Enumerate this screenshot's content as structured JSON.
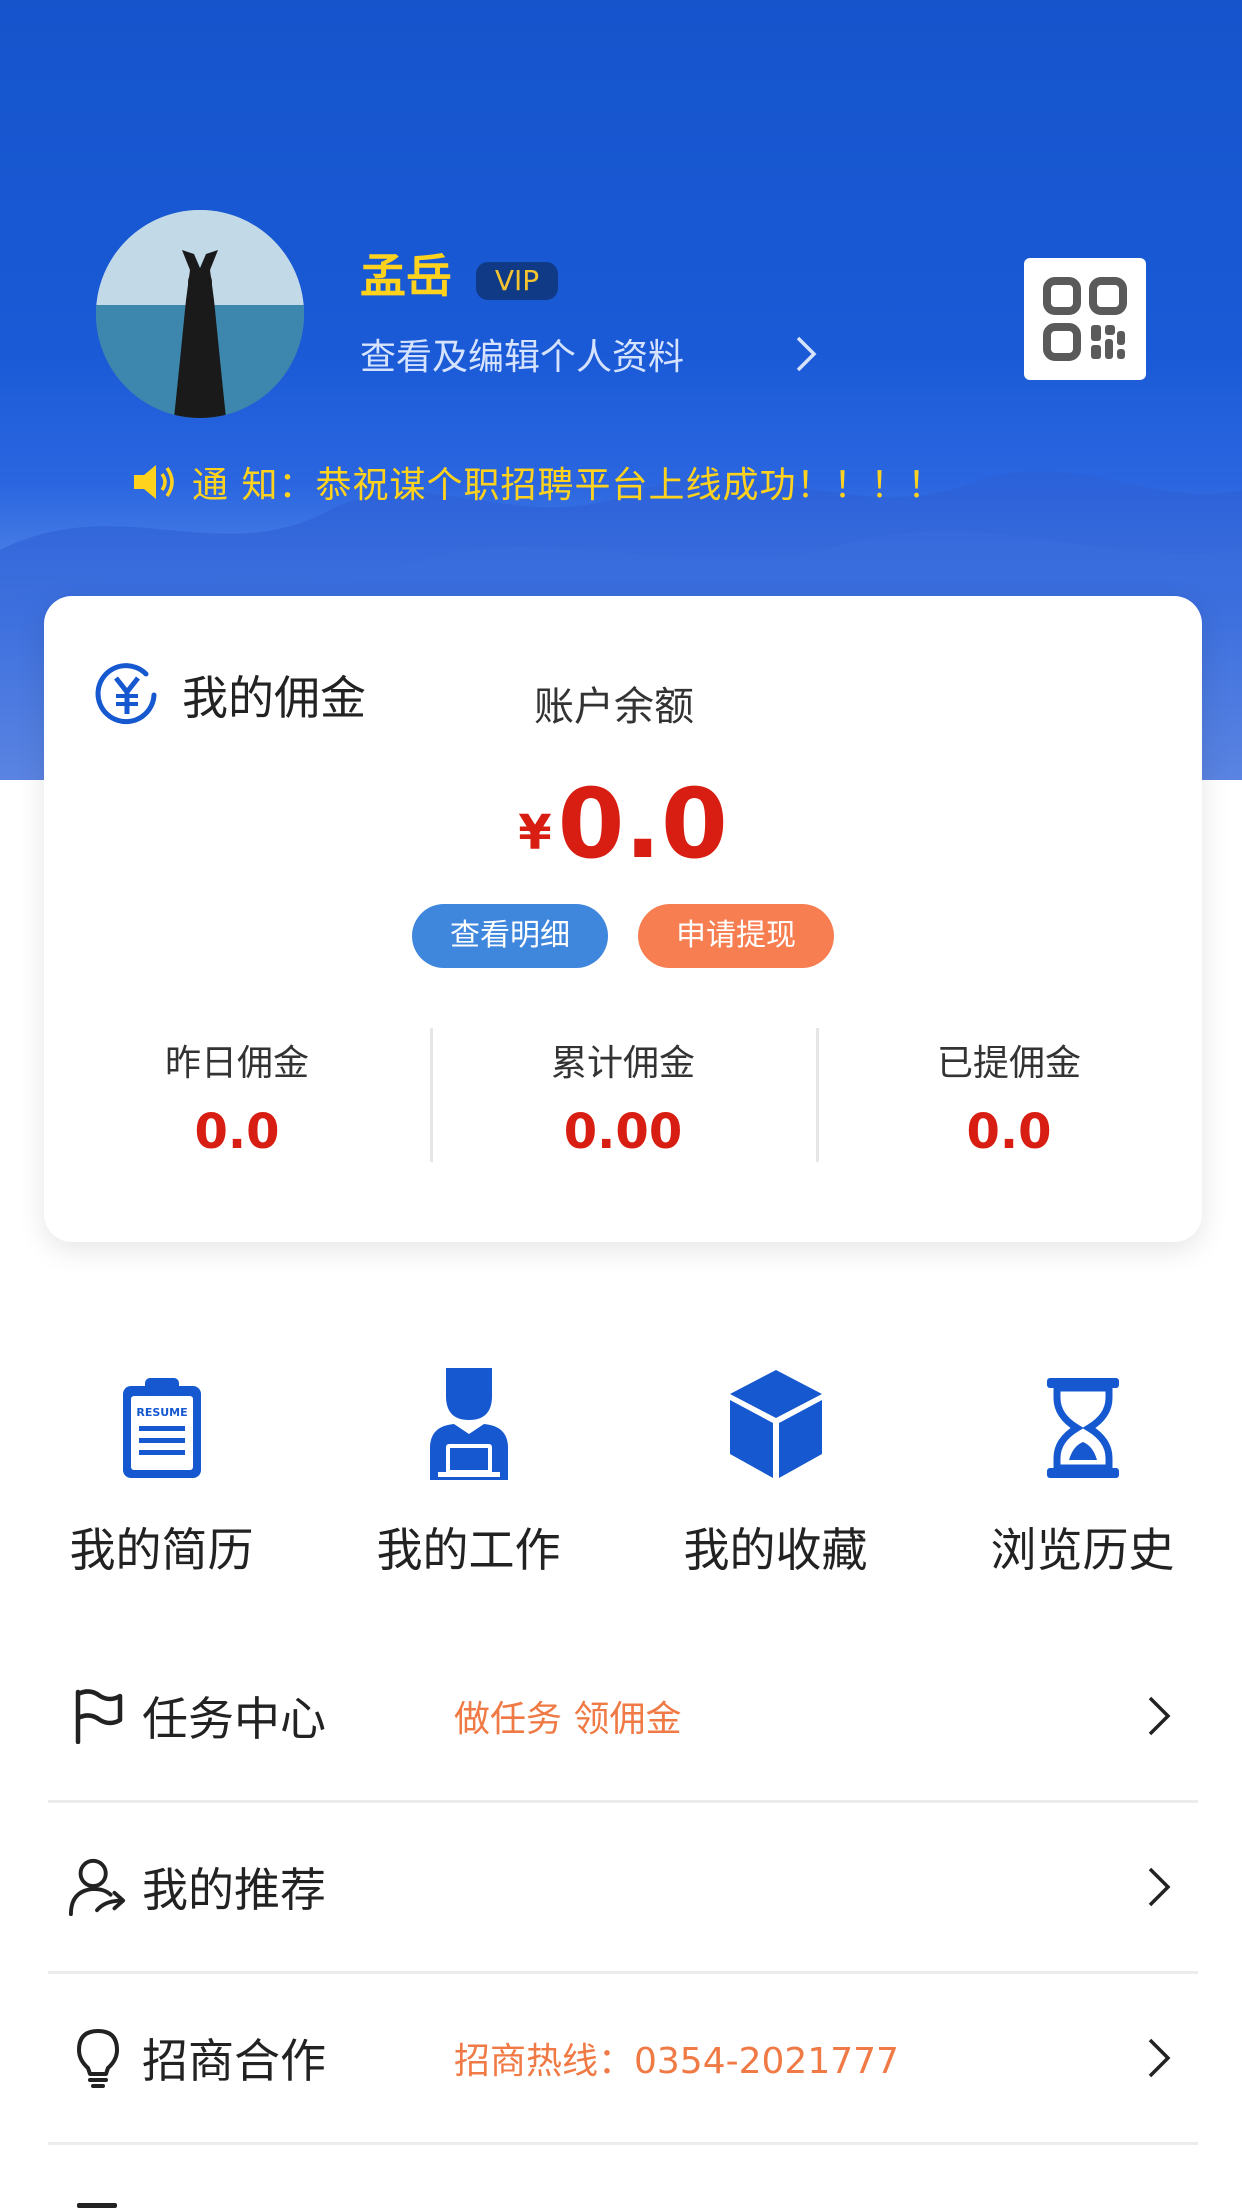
{
  "profile": {
    "name": "孟岳",
    "badge": "VIP",
    "edit_link": "查看及编辑个人资料",
    "qr_icon": "qr-code-icon"
  },
  "notice": {
    "icon": "speaker-icon",
    "text": "通 知：恭祝谋个职招聘平台上线成功！！！！"
  },
  "commission": {
    "title": "我的佣金",
    "icon": "yen-circle-icon",
    "balance_label": "账户余额",
    "currency": "¥",
    "balance": "0.0",
    "detail_button": "查看明细",
    "withdraw_button": "申请提现",
    "stats": [
      {
        "label": "昨日佣金",
        "value": "0.0"
      },
      {
        "label": "累计佣金",
        "value": "0.00"
      },
      {
        "label": "已提佣金",
        "value": "0.0"
      }
    ]
  },
  "quick_links": [
    {
      "label": "我的简历",
      "icon": "resume-icon",
      "icon_text": "RESUME"
    },
    {
      "label": "我的工作",
      "icon": "worker-icon"
    },
    {
      "label": "我的收藏",
      "icon": "cube-icon"
    },
    {
      "label": "浏览历史",
      "icon": "hourglass-icon"
    }
  ],
  "menu": [
    {
      "label": "任务中心",
      "sub": "做任务 领佣金",
      "icon": "flag-icon"
    },
    {
      "label": "我的推荐",
      "sub": "",
      "icon": "user-share-icon"
    },
    {
      "label": "招商合作",
      "sub": "招商热线：0354-2021777",
      "icon": "lightbulb-icon"
    }
  ],
  "colors": {
    "header_blue": "#1554cb",
    "accent_yellow": "#ffd21e",
    "amount_red": "#d81e12",
    "button_blue": "#3f86dd",
    "button_orange": "#f67e50",
    "icon_blue": "#1558d0",
    "sub_orange": "#f07a45"
  }
}
